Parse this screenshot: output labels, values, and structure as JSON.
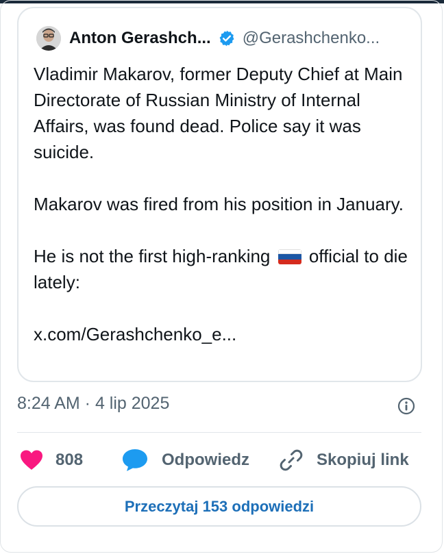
{
  "quoted_tweet": {
    "author_name": "Anton Gerashch...",
    "handle": "@Gerashchenko...",
    "paragraphs": [
      "Vladimir Makarov, former Deputy Chief at Main Directorate of Russian Ministry of Internal Affairs, was found dead. Police say it was suicide.",
      "Makarov was fired from his position in January."
    ],
    "p3_before_flag": "He is not the first high-ranking",
    "p3_after_flag": "official to die lately:",
    "link": "x.com/Gerashchenko_e..."
  },
  "meta": {
    "timestamp": "8:24 AM · 4 lip 2025"
  },
  "actions": {
    "likes_count": "808",
    "reply_label": "Odpowiedz",
    "copy_link_label": "Skopiuj link"
  },
  "read_replies_label": "Przeczytaj 153 odpowiedzi",
  "colors": {
    "like": "#f91880",
    "reply": "#1d9bf0",
    "verified": "#1d9bf0",
    "link_button_text": "#1d6fb8",
    "secondary_text": "#536471"
  },
  "icons": {
    "verified": "verified-badge-icon",
    "info": "info-icon",
    "like": "heart-icon",
    "reply": "speech-bubble-icon",
    "copy_link": "link-icon",
    "flag": "russia-flag-icon"
  }
}
